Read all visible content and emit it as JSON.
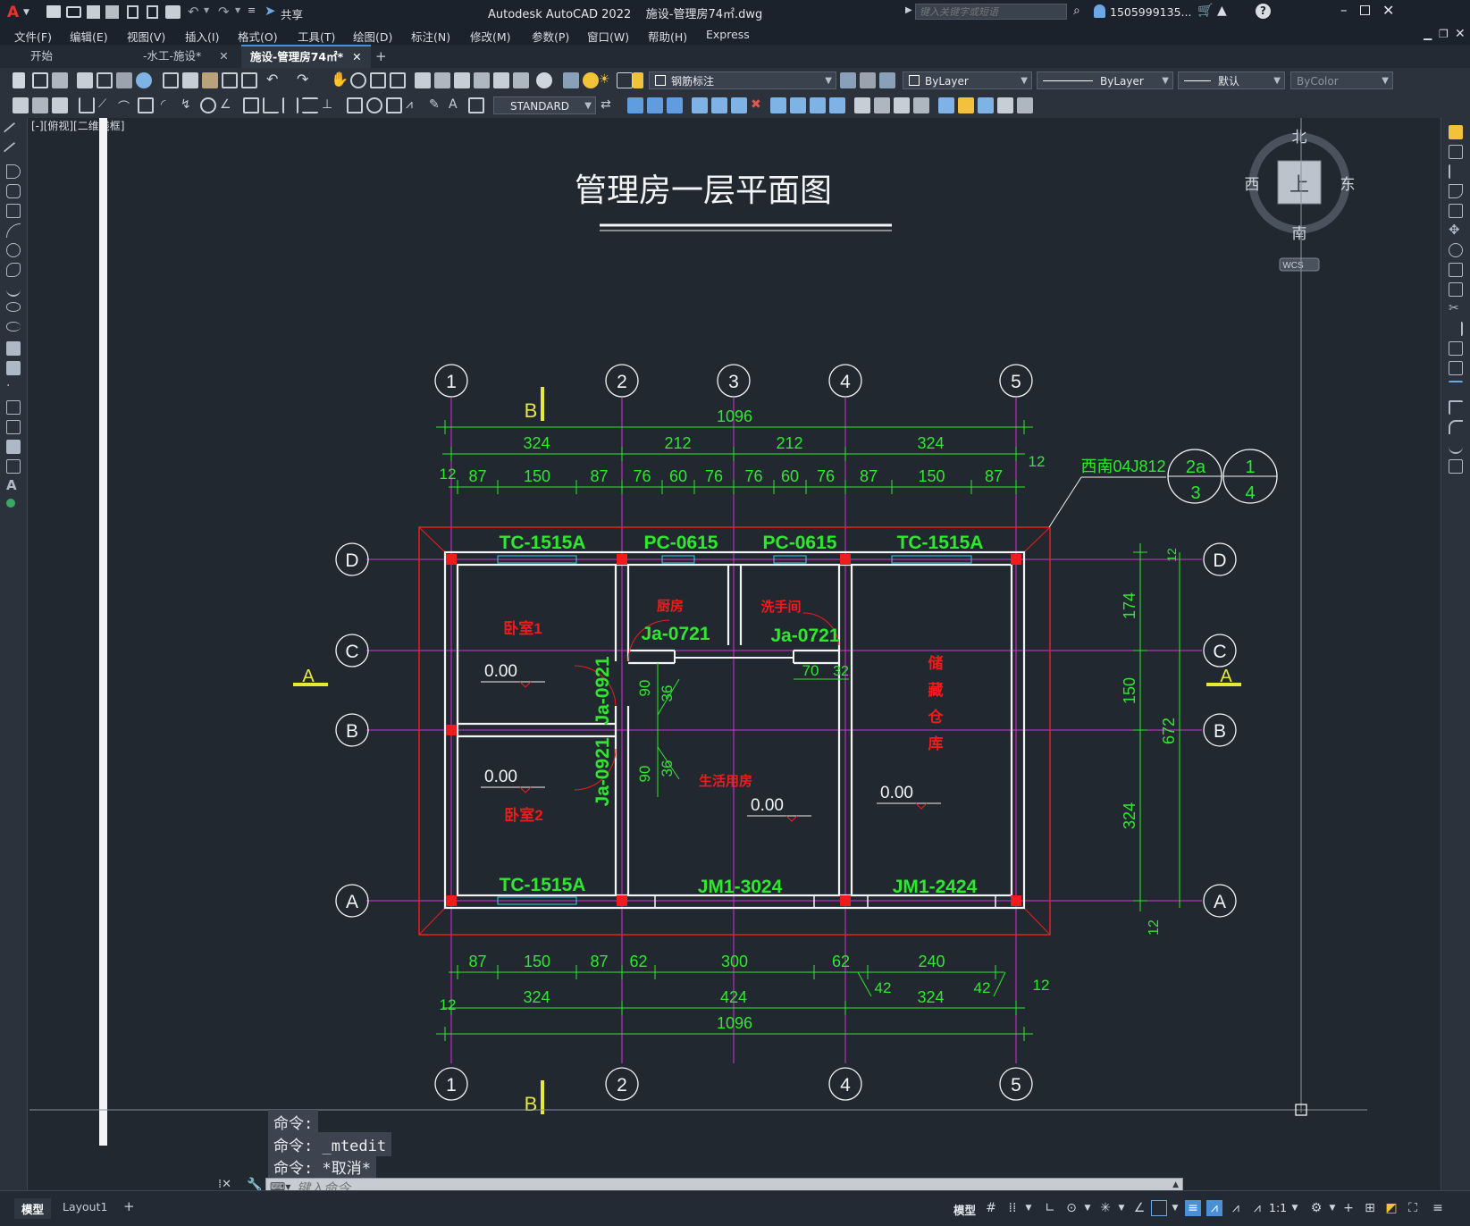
{
  "app": {
    "logo_letter": "A",
    "share_label": "共享",
    "title": "Autodesk AutoCAD 2022    施设-管理房74㎡.dwg",
    "search_placeholder": "键入关键字或短语",
    "user": "1505999135...",
    "help": "?"
  },
  "menu": [
    "文件(F)",
    "编辑(E)",
    "视图(V)",
    "插入(I)",
    "格式(O)",
    "工具(T)",
    "绘图(D)",
    "标注(N)",
    "修改(M)",
    "参数(P)",
    "窗口(W)",
    "帮助(H)",
    "Express"
  ],
  "tabs": [
    {
      "label": "开始",
      "closable": false,
      "active": false
    },
    {
      "label": "-水工-施设*",
      "closable": true,
      "active": false
    },
    {
      "label": "施设-管理房74㎡*",
      "closable": true,
      "active": true
    }
  ],
  "toolbar": {
    "layer_name": "钢筋标注",
    "color": "ByLayer",
    "linetype": "ByLayer",
    "lineweight": "默认",
    "plotstyle": "ByColor",
    "textstyle": "STANDARD"
  },
  "viewport_label": "[-][俯视][二维线框]",
  "viewcube": {
    "north": "北",
    "south": "南",
    "east": "东",
    "west": "西",
    "top": "上",
    "wcs": "WCS"
  },
  "drawing": {
    "title": "管理房一层平面图",
    "axes_top": [
      "1",
      "2",
      "3",
      "4",
      "5"
    ],
    "axes_bottom": [
      "1",
      "2",
      "4",
      "5"
    ],
    "axes_rows": [
      "D",
      "C",
      "B",
      "A"
    ],
    "section_marks": [
      "B",
      "A"
    ],
    "dims_top_total": "1096",
    "dims_top_mid": [
      "324",
      "212",
      "212",
      "324"
    ],
    "dims_top_fine": [
      "87",
      "150",
      "87",
      "76",
      "60",
      "76",
      "76",
      "60",
      "76",
      "87",
      "150",
      "87"
    ],
    "dims_edge": "12",
    "dims_bottom_fine": [
      "87",
      "150",
      "87",
      "62",
      "300",
      "62",
      "240"
    ],
    "dims_bottom_mid": [
      "324",
      "424",
      "324"
    ],
    "dims_bottom_small": [
      "42",
      "42"
    ],
    "dims_bottom_total": "1096",
    "dims_right": [
      "174",
      "150",
      "324"
    ],
    "dims_right_total": "672",
    "dims_inner": [
      "70",
      "32",
      "90",
      "36",
      "90",
      "36"
    ],
    "ref_label": "西南04J812",
    "ref_bubble_1": [
      "2a",
      "3"
    ],
    "ref_bubble_2": [
      "1",
      "4"
    ],
    "windows": [
      "TC-1515A",
      "PC-0615",
      "PC-0615",
      "TC-1515A",
      "TC-1515A"
    ],
    "doors": [
      "JM1-3024",
      "JM1-2424",
      "Ja-0721",
      "Ja-0721",
      "Ja-0921",
      "Ja-0921"
    ],
    "rooms": [
      "卧室1",
      "卧室2",
      "厨房",
      "洗手间",
      "生活用房",
      "储",
      "藏",
      "仓",
      "库"
    ],
    "elevation": "0.00"
  },
  "command": {
    "history": [
      "命令:",
      "命令: _mtedit",
      "命令: *取消*"
    ],
    "placeholder": "键入命令"
  },
  "status": {
    "layout_tabs": [
      "模型",
      "Layout1"
    ],
    "model_label": "模型",
    "scale": "1:1"
  }
}
